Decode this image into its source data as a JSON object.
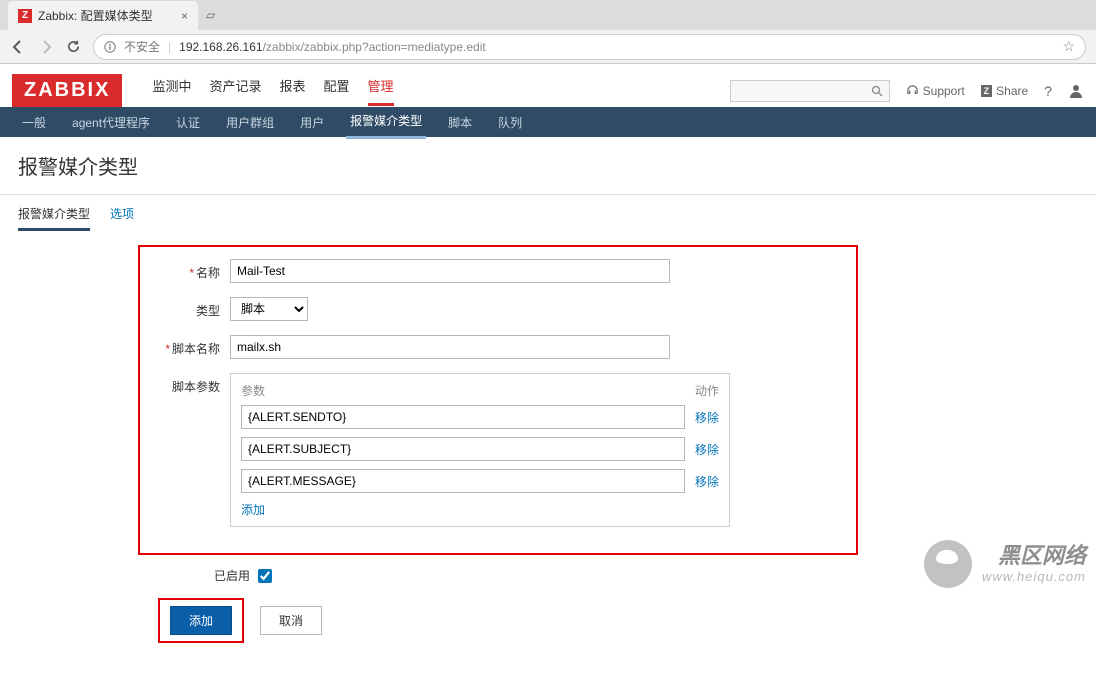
{
  "browser": {
    "tab_title": "Zabbix: 配置媒体类型",
    "favicon_letter": "Z",
    "insecure_label": "不安全",
    "url_host": "192.168.26.161",
    "url_path": "/zabbix/zabbix.php?action=mediatype.edit"
  },
  "header": {
    "logo": "ZABBIX",
    "nav": [
      "监测中",
      "资产记录",
      "报表",
      "配置",
      "管理"
    ],
    "active_nav": "管理",
    "support": "Support",
    "share": "Share",
    "share_badge": "Z"
  },
  "subnav": {
    "items": [
      "一般",
      "agent代理程序",
      "认证",
      "用户群组",
      "用户",
      "报警媒介类型",
      "脚本",
      "队列"
    ],
    "active": "报警媒介类型"
  },
  "page": {
    "title": "报警媒介类型"
  },
  "tabs": {
    "items": [
      "报警媒介类型",
      "选项"
    ],
    "active": "报警媒介类型"
  },
  "form": {
    "labels": {
      "name": "名称",
      "type": "类型",
      "script_name": "脚本名称",
      "script_params": "脚本参数",
      "enabled": "已启用"
    },
    "values": {
      "name": "Mail-Test",
      "type": "脚本",
      "script_name": "mailx.sh"
    },
    "params_header": {
      "param": "参数",
      "action": "动作"
    },
    "params": [
      "{ALERT.SENDTO}",
      "{ALERT.SUBJECT}",
      "{ALERT.MESSAGE}"
    ],
    "remove_label": "移除",
    "add_param_label": "添加",
    "buttons": {
      "add": "添加",
      "cancel": "取消"
    }
  },
  "watermark": {
    "title": "黑区网络",
    "url": "www.heiqu.com"
  }
}
